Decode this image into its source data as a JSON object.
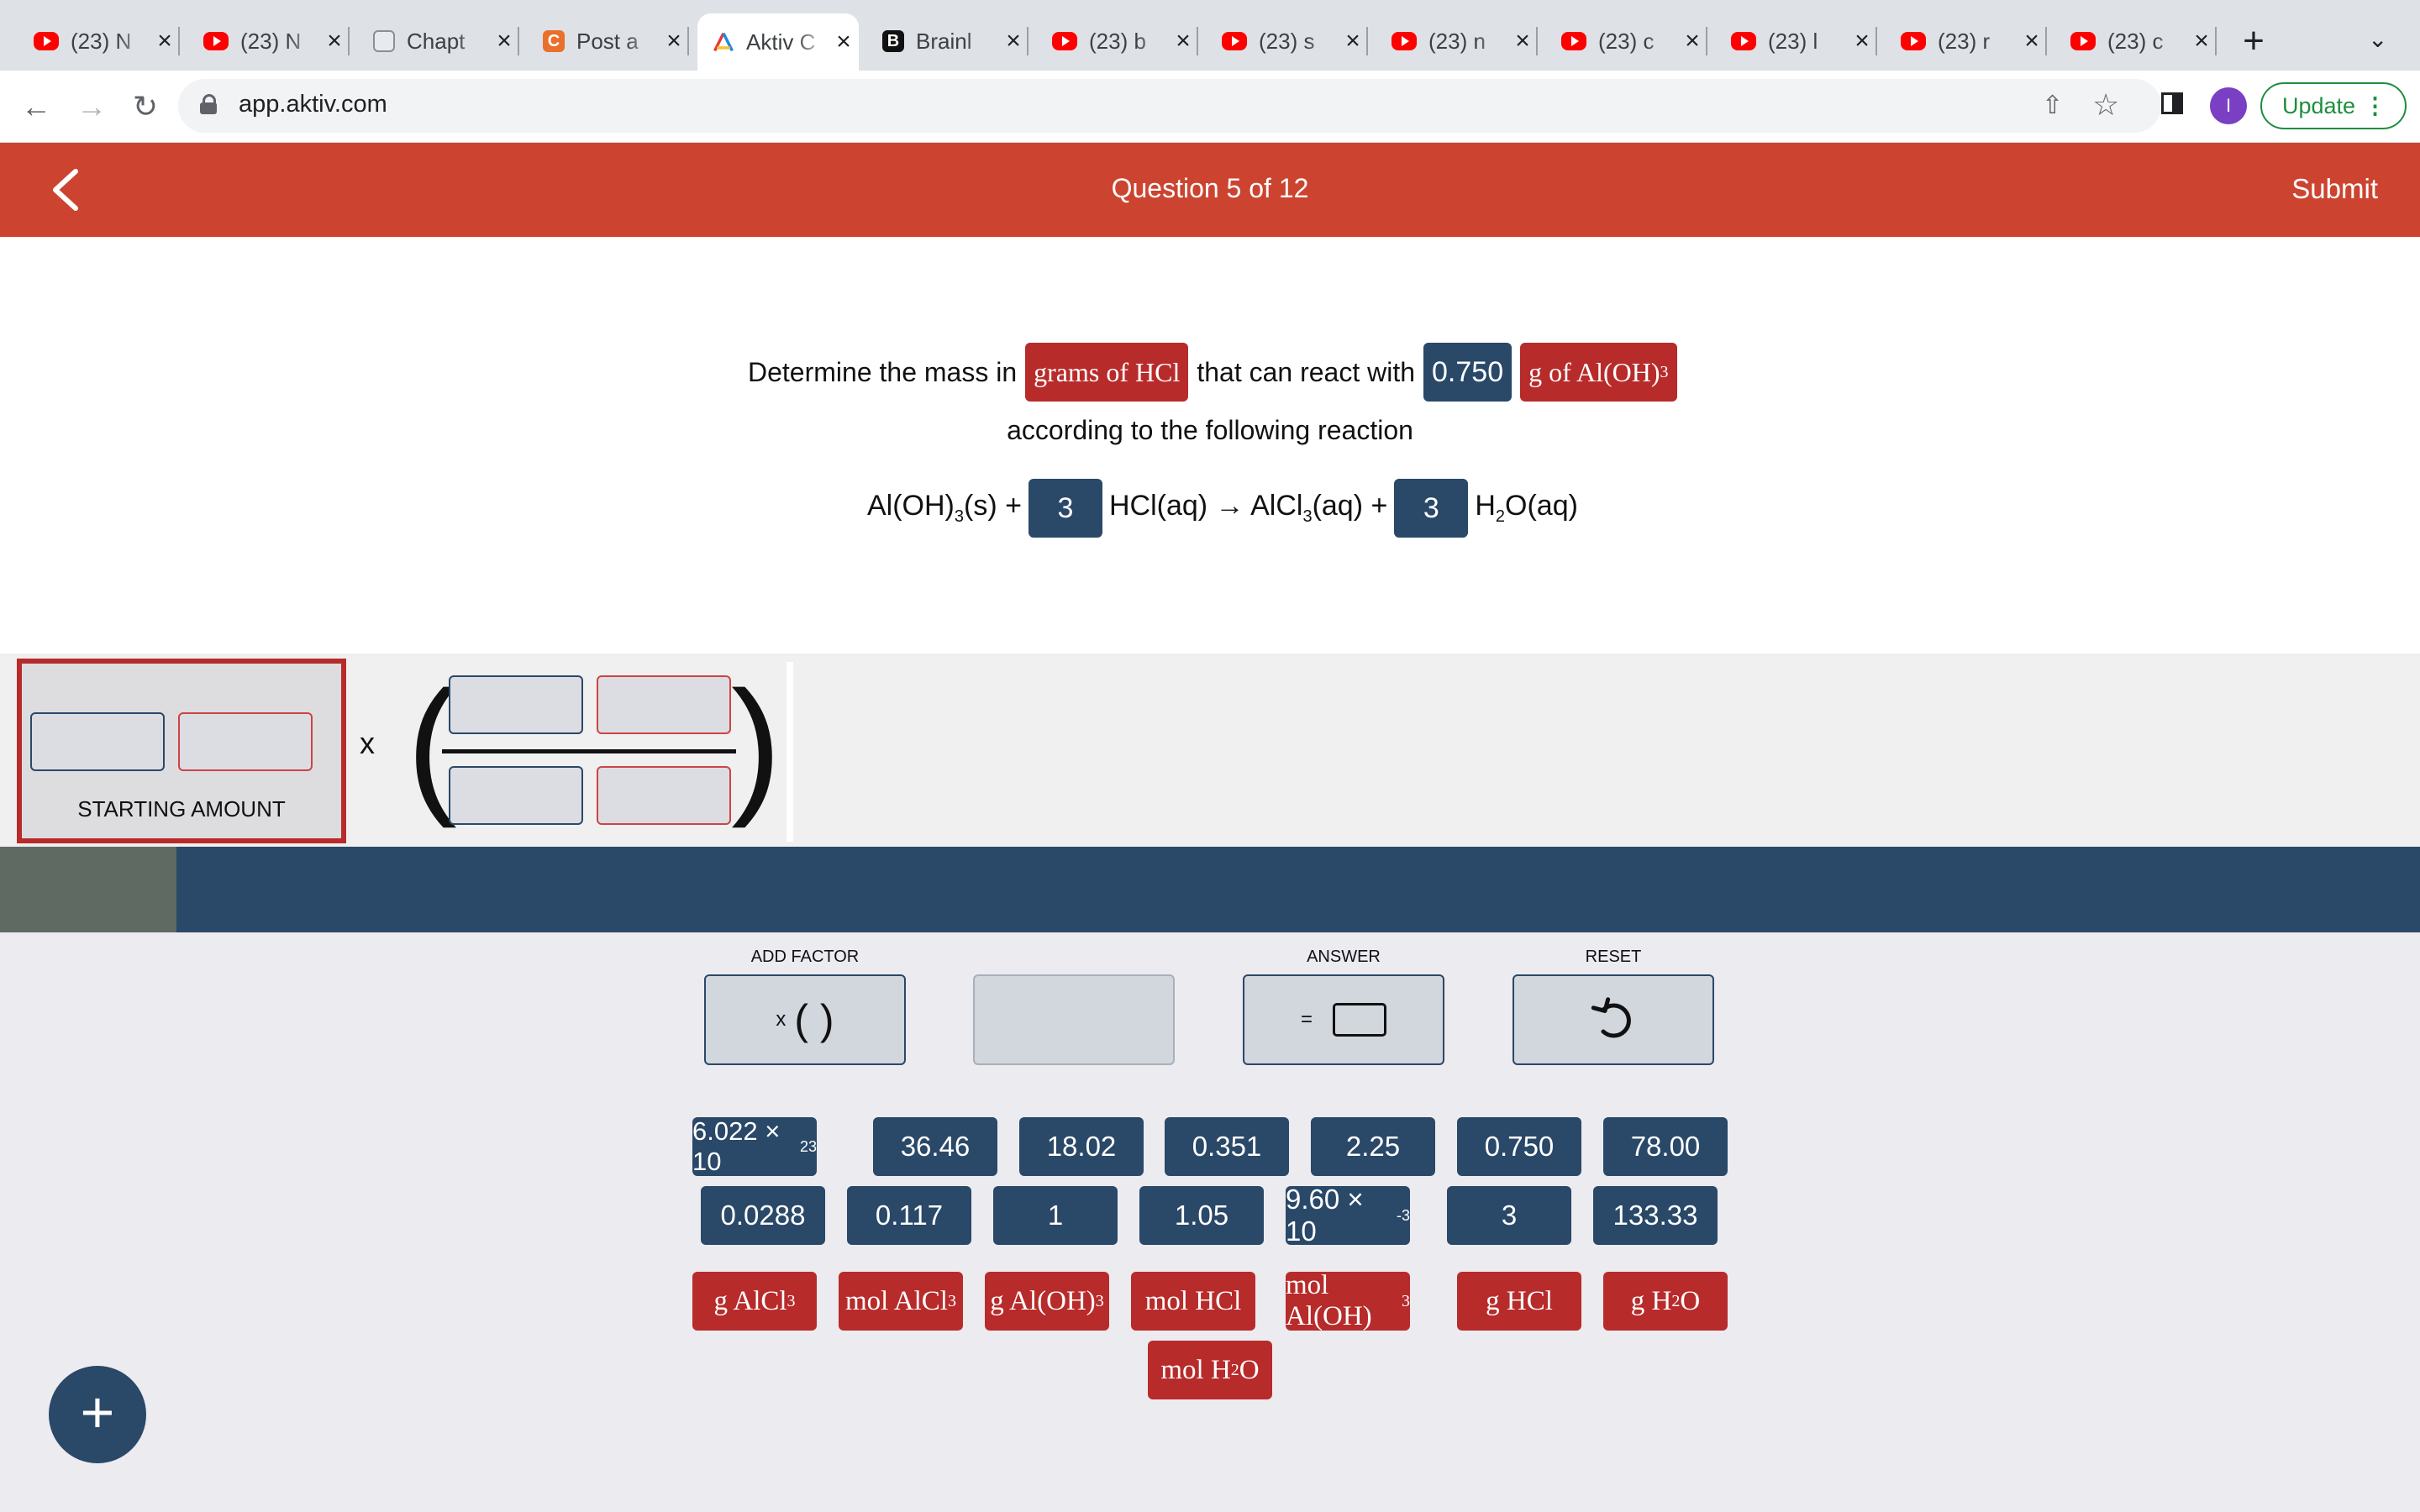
{
  "browser": {
    "tabs": [
      {
        "title": "(23) N",
        "icon": "youtube-icon"
      },
      {
        "title": "(23) N",
        "icon": "youtube-icon"
      },
      {
        "title": "Chapt",
        "icon": "chapter-icon"
      },
      {
        "title": "Post a",
        "icon": "chegg-icon"
      },
      {
        "title": "Aktiv C",
        "icon": "aktiv-icon",
        "active": true
      },
      {
        "title": "Brainl",
        "icon": "brainly-icon"
      },
      {
        "title": "(23) b",
        "icon": "youtube-icon"
      },
      {
        "title": "(23) s",
        "icon": "youtube-icon"
      },
      {
        "title": "(23) n",
        "icon": "youtube-icon"
      },
      {
        "title": "(23) c",
        "icon": "youtube-icon"
      },
      {
        "title": "(23) l",
        "icon": "youtube-icon"
      },
      {
        "title": "(23) r",
        "icon": "youtube-icon"
      },
      {
        "title": "(23) c",
        "icon": "youtube-icon"
      }
    ],
    "url": "app.aktiv.com",
    "avatar_letter": "I",
    "update_label": "Update"
  },
  "header": {
    "title": "Question 5 of 12",
    "submit_label": "Submit",
    "color": "#cc4430"
  },
  "question": {
    "prefix": "Determine the mass in",
    "target_unit": "grams of HCl",
    "middle": "that can react with",
    "given_value": "0.750",
    "given_unit_text": "g of Al(OH)",
    "given_unit_sub": "3",
    "line2": "according to the following reaction",
    "equation": {
      "r1": "Al(OH)",
      "r1_sub": "3",
      "r1_state": "(s) +",
      "coef1": "3",
      "r2": "HCl(aq) → AlCl",
      "r2_sub": "3",
      "r2_state": "(aq) +",
      "coef2": "3",
      "p2": "H",
      "p2_sub": "2",
      "p2_state": "O(aq)"
    }
  },
  "workspace": {
    "starting_amount_label": "STARTING AMOUNT",
    "times_symbol": "x",
    "progress_fraction": 0.073
  },
  "controls": {
    "add_factor_label": "ADD FACTOR",
    "answer_label": "ANSWER",
    "reset_label": "RESET",
    "add_factor_symbol": "x",
    "add_factor_parens": "(  )",
    "answer_symbol": "="
  },
  "number_chips_row1": [
    {
      "mantissa": "6.022 × 10",
      "exp": "23"
    },
    {
      "mantissa": "36.46",
      "exp": ""
    },
    {
      "mantissa": "18.02",
      "exp": ""
    },
    {
      "mantissa": "0.351",
      "exp": ""
    },
    {
      "mantissa": "2.25",
      "exp": ""
    },
    {
      "mantissa": "0.750",
      "exp": ""
    },
    {
      "mantissa": "78.00",
      "exp": ""
    }
  ],
  "number_chips_row2": [
    {
      "mantissa": "0.0288",
      "exp": ""
    },
    {
      "mantissa": "0.117",
      "exp": ""
    },
    {
      "mantissa": "1",
      "exp": ""
    },
    {
      "mantissa": "1.05",
      "exp": ""
    },
    {
      "mantissa": "9.60 × 10",
      "exp": "-3"
    },
    {
      "mantissa": "3",
      "exp": ""
    },
    {
      "mantissa": "133.33",
      "exp": ""
    }
  ],
  "unit_chips": [
    {
      "text": "g AlCl",
      "sub": "3",
      "tail": ""
    },
    {
      "text": "mol AlCl",
      "sub": "3",
      "tail": ""
    },
    {
      "text": "g Al(OH)",
      "sub": "3",
      "tail": ""
    },
    {
      "text": "mol HCl",
      "sub": "",
      "tail": ""
    },
    {
      "text": "mol Al(OH)",
      "sub": "3",
      "tail": ""
    },
    {
      "text": "g HCl",
      "sub": "",
      "tail": ""
    },
    {
      "text": "g H",
      "sub": "2",
      "tail": "O"
    },
    {
      "text": "mol H",
      "sub": "2",
      "tail": "O"
    }
  ],
  "fab_symbol": "+",
  "colors": {
    "navy": "#2a4868",
    "unit_red": "#b82b2b",
    "header_red": "#cc4430"
  }
}
